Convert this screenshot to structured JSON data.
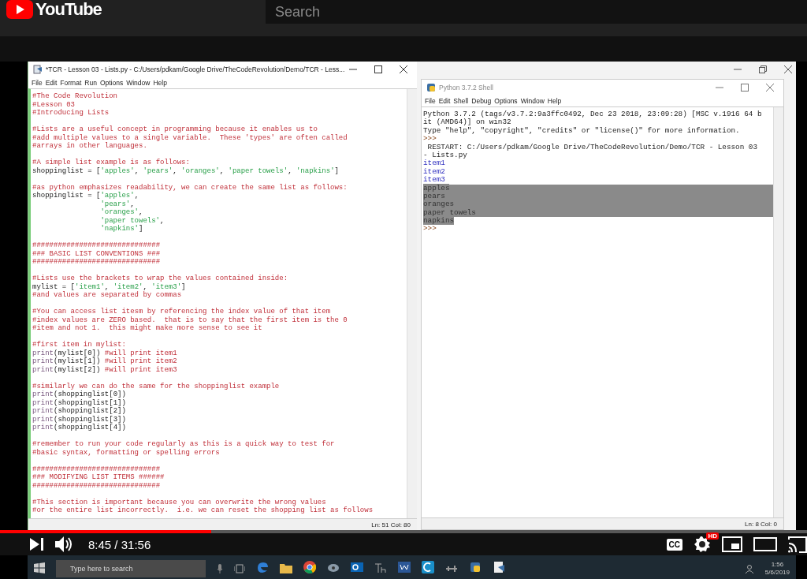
{
  "youtube": {
    "logo": "YouTube",
    "search": {
      "placeholder": "Search"
    }
  },
  "editor": {
    "title": "*TCR - Lesson 03 - Lists.py - C:/Users/pdkam/Google Drive/TheCodeRevolution/Demo/TCR - Less...",
    "menu": [
      "File",
      "Edit",
      "Format",
      "Run",
      "Options",
      "Window",
      "Help"
    ],
    "lines": [
      {
        "kind": "code",
        "parts": [
          {
            "kind": "comment",
            "text": "#The Code Revolution"
          }
        ]
      },
      {
        "kind": "code",
        "parts": [
          {
            "kind": "comment",
            "text": "#Lesson 03"
          }
        ]
      },
      {
        "kind": "code",
        "parts": [
          {
            "kind": "comment",
            "text": "#Introducing Lists"
          }
        ]
      },
      {
        "kind": "blank"
      },
      {
        "kind": "code",
        "parts": [
          {
            "kind": "comment",
            "text": "#Lists are a useful concept in programming because it enables us to"
          }
        ]
      },
      {
        "kind": "code",
        "parts": [
          {
            "kind": "comment",
            "text": "#add multiple values to a single variable.  These 'types' are often called"
          }
        ]
      },
      {
        "kind": "code",
        "parts": [
          {
            "kind": "comment",
            "text": "#arrays in other languages."
          }
        ]
      },
      {
        "kind": "blank"
      },
      {
        "kind": "code",
        "parts": [
          {
            "kind": "comment",
            "text": "#A simple list example is as follows:"
          }
        ]
      },
      {
        "kind": "code",
        "parts": [
          {
            "kind": "plain",
            "text": "shoppinglist = ["
          },
          {
            "kind": "string",
            "text": "'apples'"
          },
          {
            "kind": "plain",
            "text": ", "
          },
          {
            "kind": "string",
            "text": "'pears'"
          },
          {
            "kind": "plain",
            "text": ", "
          },
          {
            "kind": "string",
            "text": "'oranges'"
          },
          {
            "kind": "plain",
            "text": ", "
          },
          {
            "kind": "string",
            "text": "'paper towels'"
          },
          {
            "kind": "plain",
            "text": ", "
          },
          {
            "kind": "string",
            "text": "'napkins'"
          },
          {
            "kind": "plain",
            "text": "]"
          }
        ]
      },
      {
        "kind": "blank"
      },
      {
        "kind": "code",
        "parts": [
          {
            "kind": "comment",
            "text": "#as python emphasizes readability, we can create the same list as follows:"
          }
        ]
      },
      {
        "kind": "code",
        "parts": [
          {
            "kind": "plain",
            "text": "shoppinglist = ["
          },
          {
            "kind": "string",
            "text": "'apples'"
          },
          {
            "kind": "plain",
            "text": ","
          }
        ]
      },
      {
        "kind": "continuation",
        "parts": [
          {
            "kind": "string",
            "text": "'pears'"
          },
          {
            "kind": "plain",
            "text": ","
          }
        ]
      },
      {
        "kind": "continuation",
        "parts": [
          {
            "kind": "string",
            "text": "'oranges'"
          },
          {
            "kind": "plain",
            "text": ","
          }
        ]
      },
      {
        "kind": "continuation",
        "parts": [
          {
            "kind": "string",
            "text": "'paper towels'"
          },
          {
            "kind": "plain",
            "text": ","
          }
        ]
      },
      {
        "kind": "continuation",
        "parts": [
          {
            "kind": "string",
            "text": "'napkins'"
          },
          {
            "kind": "plain",
            "text": "]"
          }
        ]
      },
      {
        "kind": "blank"
      },
      {
        "kind": "code",
        "parts": [
          {
            "kind": "comment",
            "text": "##############################"
          }
        ]
      },
      {
        "kind": "code",
        "parts": [
          {
            "kind": "comment",
            "text": "### BASIC LIST CONVENTIONS ###"
          }
        ]
      },
      {
        "kind": "code",
        "parts": [
          {
            "kind": "comment",
            "text": "##############################"
          }
        ]
      },
      {
        "kind": "blank"
      },
      {
        "kind": "code",
        "parts": [
          {
            "kind": "comment",
            "text": "#Lists use the brackets to wrap the values contained inside:"
          }
        ]
      },
      {
        "kind": "code",
        "parts": [
          {
            "kind": "plain",
            "text": "mylist = ["
          },
          {
            "kind": "string",
            "text": "'item1'"
          },
          {
            "kind": "plain",
            "text": ", "
          },
          {
            "kind": "string",
            "text": "'item2'"
          },
          {
            "kind": "plain",
            "text": ", "
          },
          {
            "kind": "string",
            "text": "'item3'"
          },
          {
            "kind": "plain",
            "text": "]"
          }
        ]
      },
      {
        "kind": "code",
        "parts": [
          {
            "kind": "comment",
            "text": "#and values are separated by commas"
          }
        ]
      },
      {
        "kind": "blank"
      },
      {
        "kind": "code",
        "parts": [
          {
            "kind": "comment",
            "text": "#You can access list itesm by referencing the index value of that item"
          }
        ]
      },
      {
        "kind": "code",
        "parts": [
          {
            "kind": "comment",
            "text": "#index values are ZERO based.  that is to say that the first item is the 0"
          }
        ]
      },
      {
        "kind": "code",
        "parts": [
          {
            "kind": "comment",
            "text": "#item and not 1.  this might make more sense to see it"
          }
        ]
      },
      {
        "kind": "blank"
      },
      {
        "kind": "code",
        "parts": [
          {
            "kind": "comment",
            "text": "#first item in mylist:"
          }
        ]
      },
      {
        "kind": "code",
        "parts": [
          {
            "kind": "builtin",
            "text": "print"
          },
          {
            "kind": "plain",
            "text": "(mylist[0]) "
          },
          {
            "kind": "comment",
            "text": "#will print item1"
          }
        ]
      },
      {
        "kind": "code",
        "parts": [
          {
            "kind": "builtin",
            "text": "print"
          },
          {
            "kind": "plain",
            "text": "(mylist[1]) "
          },
          {
            "kind": "comment",
            "text": "#will print item2"
          }
        ]
      },
      {
        "kind": "code",
        "parts": [
          {
            "kind": "builtin",
            "text": "print"
          },
          {
            "kind": "plain",
            "text": "(mylist[2]) "
          },
          {
            "kind": "comment",
            "text": "#will print item3"
          }
        ]
      },
      {
        "kind": "blank"
      },
      {
        "kind": "code",
        "parts": [
          {
            "kind": "comment",
            "text": "#similarly we can do the same for the shoppinglist example"
          }
        ]
      },
      {
        "kind": "code",
        "parts": [
          {
            "kind": "builtin",
            "text": "print"
          },
          {
            "kind": "plain",
            "text": "(shoppinglist[0])"
          }
        ]
      },
      {
        "kind": "code",
        "parts": [
          {
            "kind": "builtin",
            "text": "print"
          },
          {
            "kind": "plain",
            "text": "(shoppinglist[1])"
          }
        ]
      },
      {
        "kind": "code",
        "parts": [
          {
            "kind": "builtin",
            "text": "print"
          },
          {
            "kind": "plain",
            "text": "(shoppinglist[2])"
          }
        ]
      },
      {
        "kind": "code",
        "parts": [
          {
            "kind": "builtin",
            "text": "print"
          },
          {
            "kind": "plain",
            "text": "(shoppinglist[3])"
          }
        ]
      },
      {
        "kind": "code",
        "parts": [
          {
            "kind": "builtin",
            "text": "print"
          },
          {
            "kind": "plain",
            "text": "(shoppinglist[4])"
          }
        ]
      },
      {
        "kind": "blank"
      },
      {
        "kind": "code",
        "parts": [
          {
            "kind": "comment",
            "text": "#remember to run your code regularly as this is a quick way to test for"
          }
        ]
      },
      {
        "kind": "code",
        "parts": [
          {
            "kind": "comment",
            "text": "#basic syntax, formatting or spelling errors"
          }
        ]
      },
      {
        "kind": "blank"
      },
      {
        "kind": "code",
        "parts": [
          {
            "kind": "comment",
            "text": "##############################"
          }
        ]
      },
      {
        "kind": "code",
        "parts": [
          {
            "kind": "comment",
            "text": "### MODIFYING LIST ITEMS ######"
          }
        ]
      },
      {
        "kind": "code",
        "parts": [
          {
            "kind": "comment",
            "text": "##############################"
          }
        ]
      },
      {
        "kind": "blank"
      },
      {
        "kind": "code",
        "parts": [
          {
            "kind": "comment",
            "text": "#This section is important because you can overwrite the wrong values"
          }
        ]
      },
      {
        "kind": "code",
        "parts": [
          {
            "kind": "comment",
            "text": "#or the entire list incorrectly.  i.e. we can reset the shopping list as follows"
          }
        ]
      }
    ],
    "status": "Ln: 51  Col: 80"
  },
  "shell": {
    "title": "Python 3.7.2 Shell",
    "menu": [
      "File",
      "Edit",
      "Shell",
      "Debug",
      "Options",
      "Window",
      "Help"
    ],
    "lines": [
      {
        "kind": "output",
        "text": "Python 3.7.2 (tags/v3.7.2:9a3ffc0492, Dec 23 2018, 23:09:28) [MSC v.1916 64 b",
        "selected": false
      },
      {
        "kind": "output",
        "text": "it (AMD64)] on win32",
        "selected": false
      },
      {
        "kind": "output",
        "text": "Type \"help\", \"copyright\", \"credits\" or \"license()\" for more information.",
        "selected": false
      },
      {
        "kind": "prompt",
        "text": ">>>",
        "selected": false
      },
      {
        "kind": "output",
        "text": " RESTART: C:/Users/pdkam/Google Drive/TheCodeRevolution/Demo/TCR - Lesson 03",
        "selected": false
      },
      {
        "kind": "output",
        "text": "- Lists.py",
        "selected": false
      },
      {
        "kind": "stdout",
        "text": "item1",
        "selected": false
      },
      {
        "kind": "stdout",
        "text": "item2",
        "selected": false
      },
      {
        "kind": "stdout",
        "text": "item3",
        "selected": false
      },
      {
        "kind": "stdout",
        "text": "apples",
        "selected": true
      },
      {
        "kind": "stdout",
        "text": "pears",
        "selected": true
      },
      {
        "kind": "stdout",
        "text": "oranges",
        "selected": true
      },
      {
        "kind": "stdout",
        "text": "paper towels",
        "selected": true
      },
      {
        "kind": "stdout",
        "text": "napkins",
        "selected": true
      },
      {
        "kind": "prompt",
        "text": ">>>",
        "selected": false
      }
    ],
    "status": "Ln: 8  Col: 0"
  },
  "taskbar": {
    "search": {
      "placeholder": "Type here to search"
    },
    "time": "1:56",
    "date": "5/6/2019"
  },
  "player": {
    "progress": {
      "level": 0.262
    },
    "time": "8:45 / 31:56",
    "captions": "CC",
    "quality_badge": "HD"
  }
}
